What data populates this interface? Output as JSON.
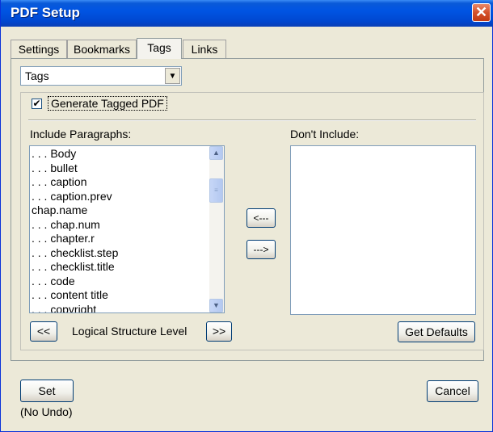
{
  "window": {
    "title": "PDF Setup",
    "close_icon": "close-icon",
    "close_glyph": "✕"
  },
  "tabs": [
    {
      "label": "Settings",
      "active": false
    },
    {
      "label": "Bookmarks",
      "active": false
    },
    {
      "label": "Tags",
      "active": true
    },
    {
      "label": "Links",
      "active": false
    }
  ],
  "dropdown": {
    "selected": "Tags",
    "arrow_glyph": "▼"
  },
  "checkbox": {
    "label": "Generate Tagged PDF",
    "checked": true,
    "check_glyph": "✔"
  },
  "include": {
    "label": "Include Paragraphs:",
    "items": [
      ". . . Body",
      ". . . bullet",
      ". . . caption",
      ". . . caption.prev",
      "chap.name",
      ". . . chap.num",
      ". . . chapter.r",
      ". . . checklist.step",
      ". . . checklist.title",
      ". . . code",
      ". . . content title",
      ". . . copyright"
    ],
    "scroll_up_glyph": "▲",
    "scroll_down_glyph": "▼",
    "scroll_thumb_glyph": "≡"
  },
  "exclude": {
    "label": "Don't Include:",
    "items": []
  },
  "move_left_label": "<---",
  "move_right_label": "--->",
  "level": {
    "prev_label": "<<",
    "label": "Logical Structure Level",
    "next_label": ">>"
  },
  "get_defaults_label": "Get Defaults",
  "set_label": "Set",
  "cancel_label": "Cancel",
  "undo_status": "(No Undo)"
}
